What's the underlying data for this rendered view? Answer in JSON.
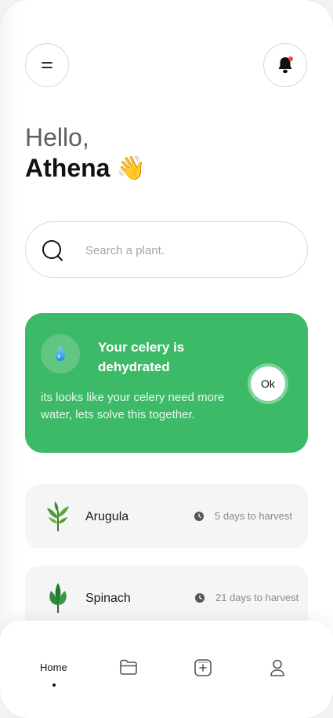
{
  "header": {
    "menu_icon": "menu-icon",
    "bell_icon": "bell-icon",
    "notification_color": "#f04a3e"
  },
  "greeting": {
    "hello": "Hello,",
    "name": "Athena",
    "emoji": "👋"
  },
  "search": {
    "placeholder": "Search a plant.",
    "value": ""
  },
  "alert": {
    "title": "Your celery is dehydrated",
    "body": "its looks like your celery need more water, lets solve this together.",
    "ok_label": "Ok",
    "icon": "water-drop-icon",
    "color": "#3dba67"
  },
  "plants": [
    {
      "name": "Arugula",
      "harvest": "5 days to harvest"
    },
    {
      "name": "Spinach",
      "harvest": "21 days to harvest"
    }
  ],
  "tabs": {
    "home_label": "Home",
    "items": [
      "home",
      "folder-icon",
      "add-icon",
      "profile-icon"
    ]
  }
}
